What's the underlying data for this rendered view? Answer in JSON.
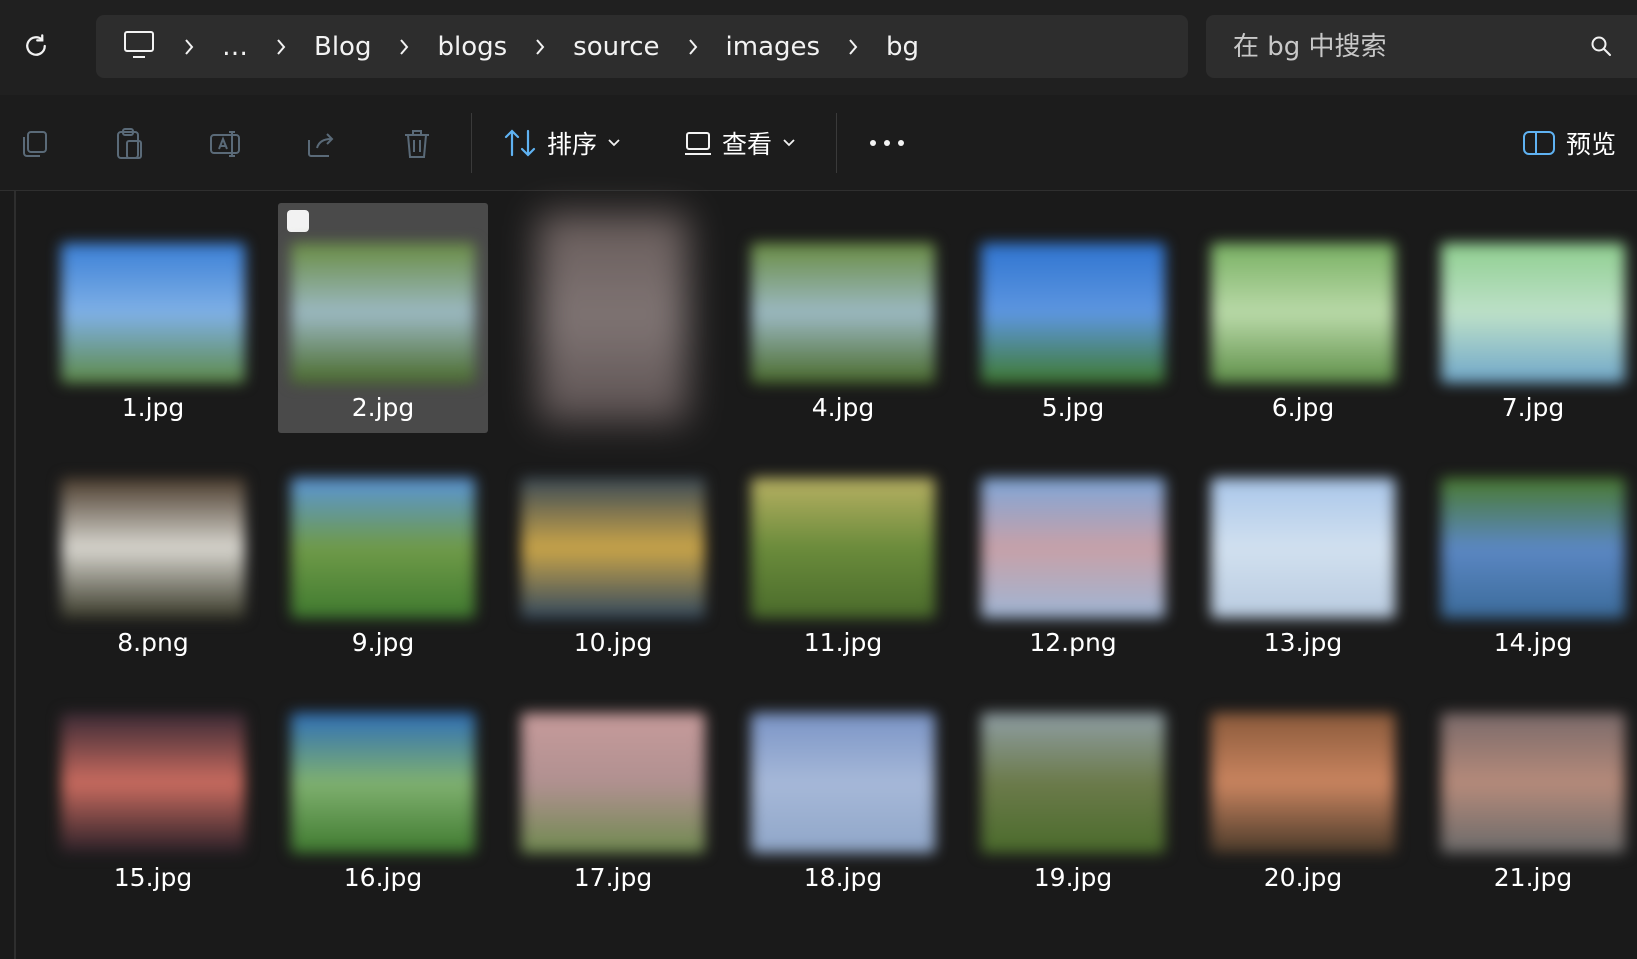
{
  "address_bar": {
    "breadcrumbs": [
      {
        "label": "…"
      },
      {
        "label": "Blog"
      },
      {
        "label": "blogs"
      },
      {
        "label": "source"
      },
      {
        "label": "images"
      },
      {
        "label": "bg"
      }
    ]
  },
  "search": {
    "placeholder": "在 bg 中搜索"
  },
  "toolbar": {
    "sort_label": "排序",
    "view_label": "查看",
    "preview_label": "预览"
  },
  "files": [
    {
      "name": "1.jpg",
      "colors": [
        "#3a7fd6",
        "#7fb0e6",
        "#5e8a46"
      ]
    },
    {
      "name": "2.jpg",
      "colors": [
        "#6a8d43",
        "#9bb8c2",
        "#4a6b2b"
      ],
      "selected": true
    },
    {
      "name": "",
      "colors": [
        "#7b6c6a",
        "#9a8c8b",
        "#6b5e5e"
      ]
    },
    {
      "name": "4.jpg",
      "colors": [
        "#6a8d43",
        "#9bb8c2",
        "#4a6b2b"
      ]
    },
    {
      "name": "5.jpg",
      "colors": [
        "#2f74d0",
        "#5d96e0",
        "#3f7a2f"
      ]
    },
    {
      "name": "6.jpg",
      "colors": [
        "#78b062",
        "#b9d9a8",
        "#5e8f48"
      ]
    },
    {
      "name": "7.jpg",
      "colors": [
        "#8fcf8f",
        "#bde0c8",
        "#6fa6c9"
      ]
    },
    {
      "name": "8.png",
      "colors": [
        "#4a3b2c",
        "#d8d6cf",
        "#3a3a2a"
      ]
    },
    {
      "name": "9.jpg",
      "colors": [
        "#5a95d9",
        "#6f9a48",
        "#3f7a2f"
      ]
    },
    {
      "name": "10.jpg",
      "colors": [
        "#3b4a57",
        "#c9a448",
        "#33495f"
      ]
    },
    {
      "name": "11.jpg",
      "colors": [
        "#b9b163",
        "#6a8b3b",
        "#4a6b2b"
      ]
    },
    {
      "name": "12.png",
      "colors": [
        "#7fa6d8",
        "#c7a0a7",
        "#9fb6d5"
      ]
    },
    {
      "name": "13.jpg",
      "colors": [
        "#a9c6ea",
        "#d1e0ef",
        "#b9cbe0"
      ]
    },
    {
      "name": "14.jpg",
      "colors": [
        "#4a7a2f",
        "#5b87c3",
        "#3b6b9a"
      ]
    },
    {
      "name": "15.jpg",
      "colors": [
        "#3a2a35",
        "#c96b5f",
        "#2a2028"
      ]
    },
    {
      "name": "16.jpg",
      "colors": [
        "#2f6fb8",
        "#7fb06f",
        "#3f7a2f"
      ]
    },
    {
      "name": "17.jpg",
      "colors": [
        "#c79b9b",
        "#b09090",
        "#6f8a4f"
      ]
    },
    {
      "name": "18.jpg",
      "colors": [
        "#7a94c6",
        "#a6b8d8",
        "#8fa6c8"
      ]
    },
    {
      "name": "19.jpg",
      "colors": [
        "#8f9ea5",
        "#6b7a4a",
        "#4a6b2b"
      ]
    },
    {
      "name": "20.jpg",
      "colors": [
        "#8a5a3b",
        "#c9845f",
        "#4a3a2a"
      ]
    },
    {
      "name": "21.jpg",
      "colors": [
        "#7a6a6a",
        "#b58a7a",
        "#6a6a6a"
      ]
    }
  ]
}
